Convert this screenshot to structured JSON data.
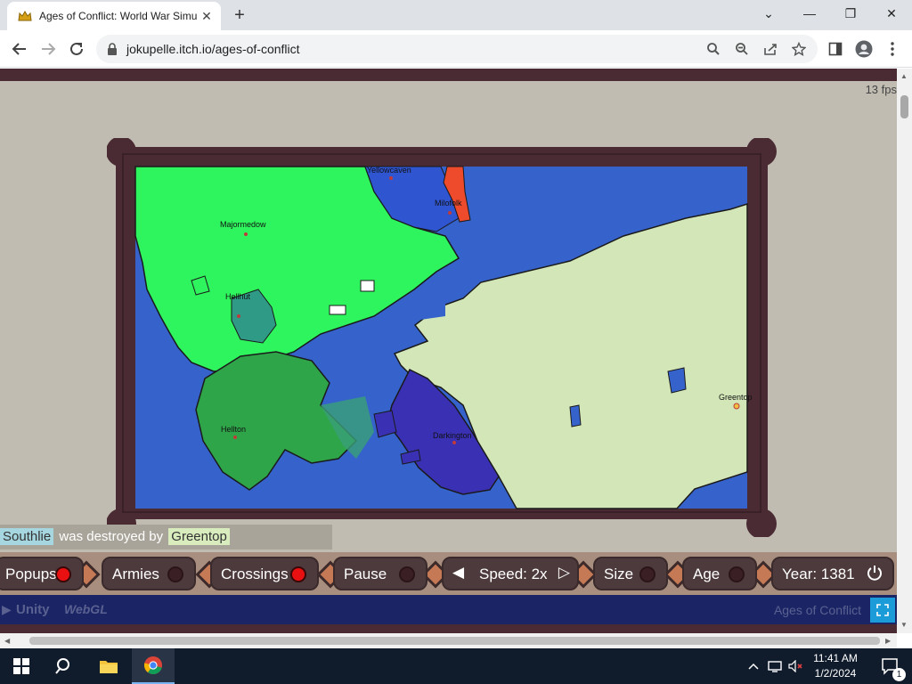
{
  "browser": {
    "tab_title": "Ages of Conflict: World War Simu",
    "url": "jokupelle.itch.io/ages-of-conflict"
  },
  "game": {
    "fps": "13 fps",
    "cities": [
      {
        "name": "Yellowcaven",
        "color": "#ffffff"
      },
      {
        "name": "Milofolk",
        "color": "#ffffff"
      },
      {
        "name": "Majormedow",
        "color": "#ffffff"
      },
      {
        "name": "Hellhut",
        "color": "#ffffff"
      },
      {
        "name": "Greentop",
        "color": "#ffffff"
      },
      {
        "name": "Hellton",
        "color": "#ffffff"
      },
      {
        "name": "Darkington",
        "color": "#ffffff"
      }
    ],
    "log": {
      "victim": "Southlie",
      "middle": "was destroyed by",
      "attacker": "Greentop"
    },
    "controls": {
      "popups": "Popups",
      "armies": "Armies",
      "crossings": "Crossings",
      "pause": "Pause",
      "speed": "Speed: 2x",
      "size": "Size",
      "age": "Age",
      "year": "Year: 1381"
    },
    "toggles": {
      "popups": true,
      "armies": false,
      "crossings": true,
      "pause": false,
      "size": false,
      "age": false
    },
    "footer_title": "Ages of Conflict",
    "unity_label": "Unity",
    "webgl_label": "WebGL",
    "colors": {
      "sea": "#3663cb",
      "greentop": "#d3e6b8",
      "north_green": "#2ef55d",
      "hellton_green": "#2fa54a",
      "darkington_blue": "#3a30b4",
      "yellowcaven_blue": "#2f55d1",
      "milofolk_red": "#ee4a2c",
      "frame": "#4a2b34"
    }
  },
  "taskbar": {
    "time": "11:41 AM",
    "date": "1/2/2024",
    "notifications": "1"
  }
}
